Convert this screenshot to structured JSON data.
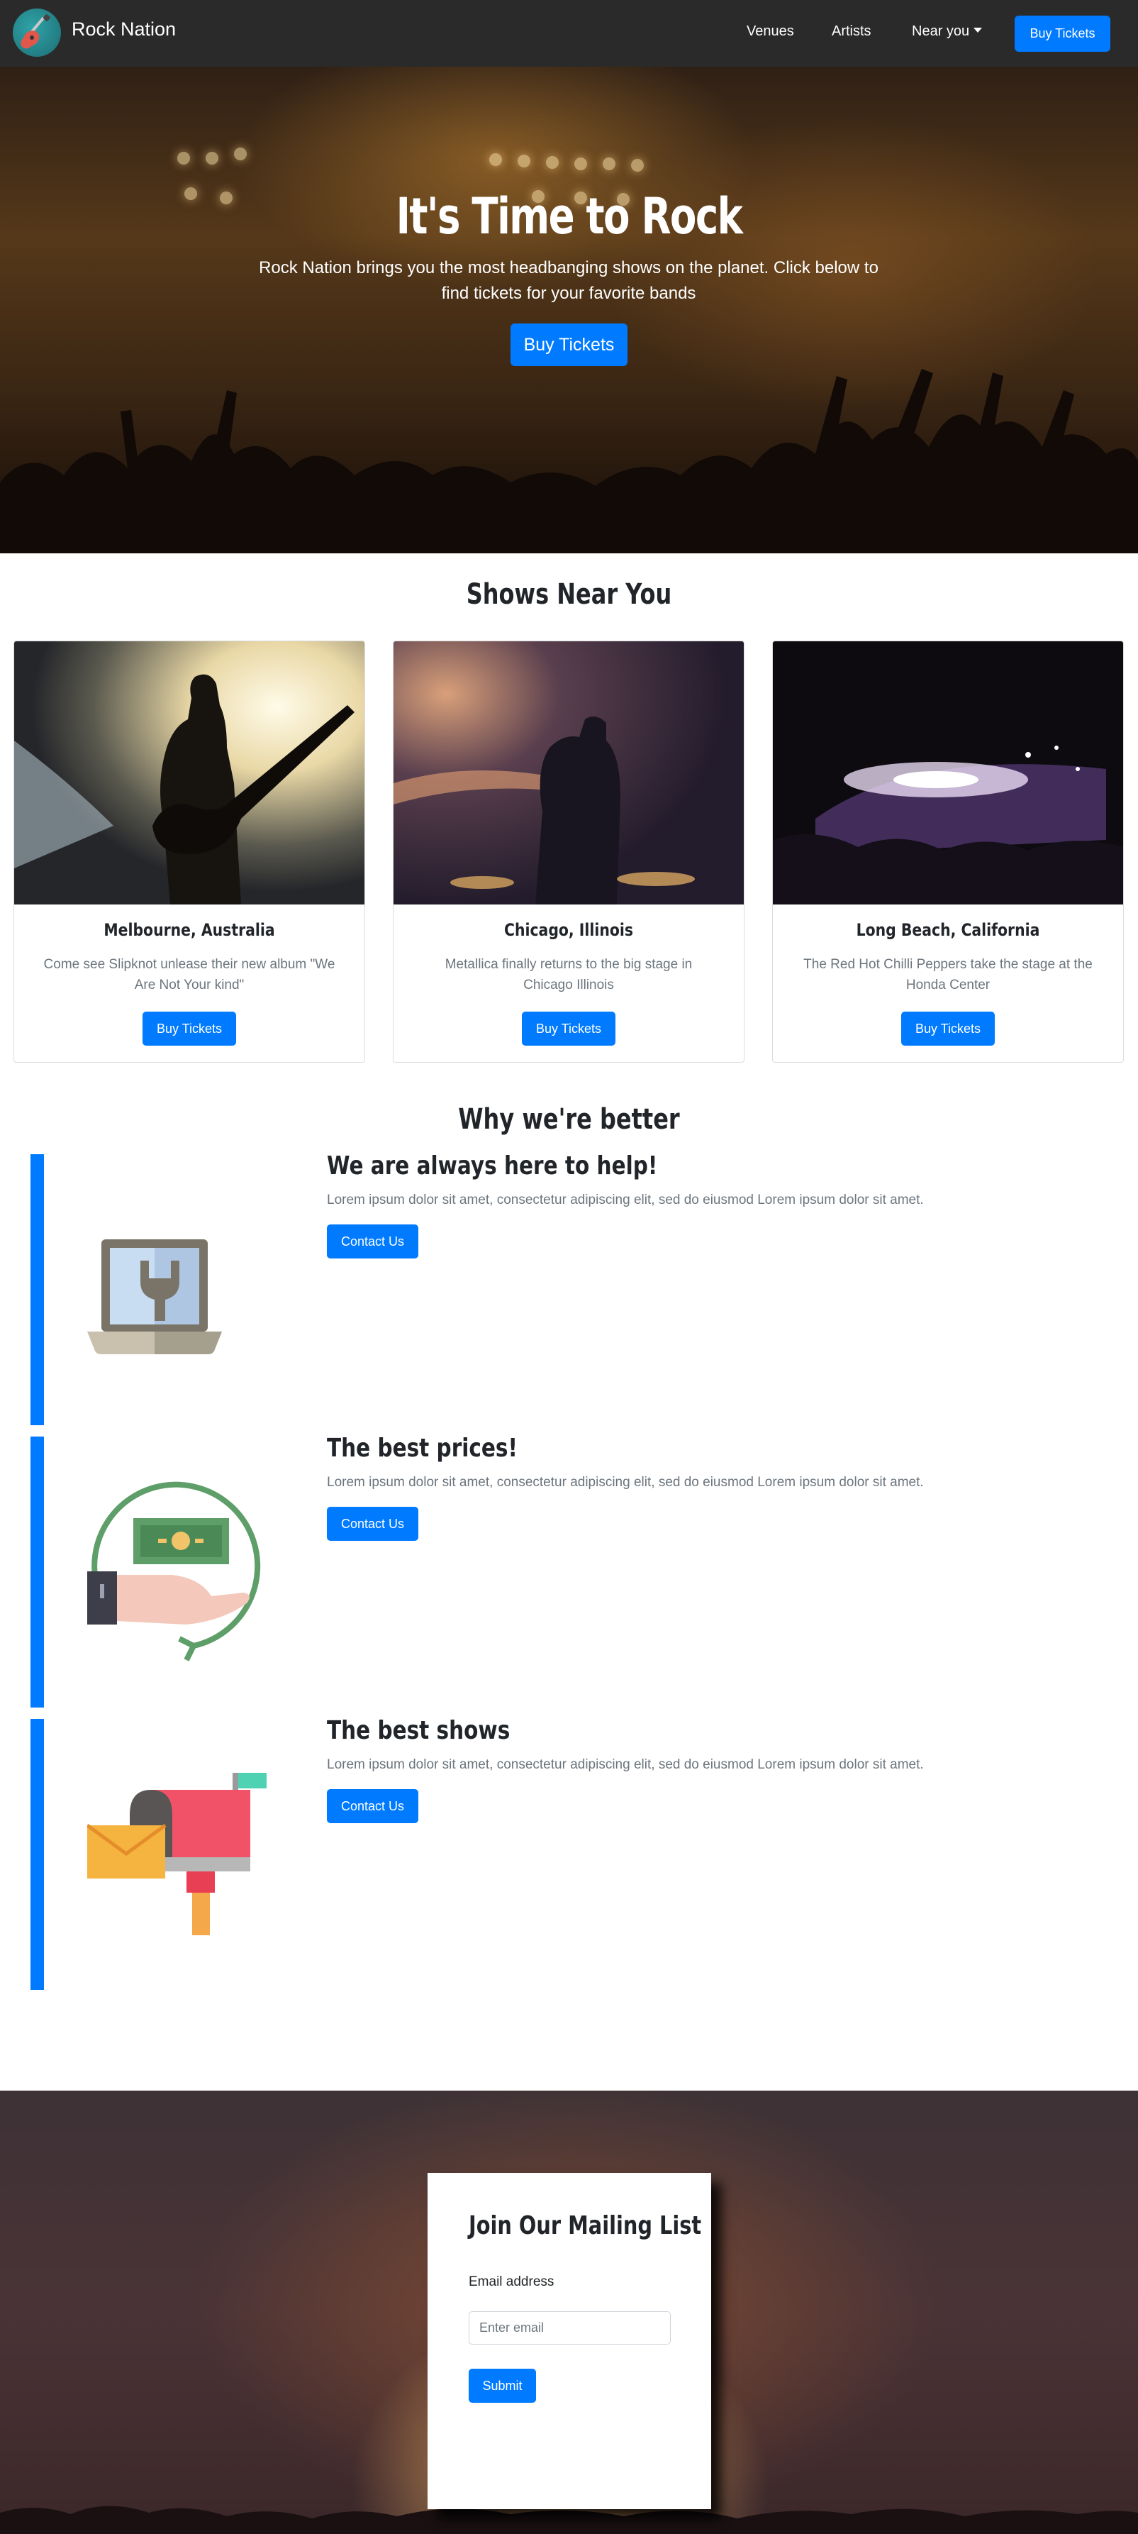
{
  "nav": {
    "brand": "Rock Nation",
    "links": [
      "Venues",
      "Artists",
      "Near you"
    ],
    "buy_label": "Buy Tickets"
  },
  "hero": {
    "title": "It's Time to Rock",
    "subtitle": "Rock Nation brings you the most headbanging shows on the planet. Click below to find tickets for your favorite bands",
    "button": "Buy Tickets"
  },
  "shows": {
    "heading": "Shows Near You",
    "cards": [
      {
        "title": "Melbourne, Australia",
        "text": "Come see Slipknot unlease their new album \"We Are Not Your kind\"",
        "button": "Buy Tickets"
      },
      {
        "title": "Chicago, Illinois",
        "text": "Metallica finally returns to the big stage in Chicago Illinois",
        "button": "Buy Tickets"
      },
      {
        "title": "Long Beach, California",
        "text": "The Red Hot Chilli Peppers take the stage at the Honda Center",
        "button": "Buy Tickets"
      }
    ]
  },
  "why": {
    "heading": "Why we're better",
    "features": [
      {
        "title": "We are always here to help!",
        "text": "Lorem ipsum dolor sit amet, consectetur adipiscing elit, sed do eiusmod Lorem ipsum dolor sit amet.",
        "button": "Contact Us",
        "icon": "laptop-wrench-icon"
      },
      {
        "title": "The best prices!",
        "text": "Lorem ipsum dolor sit amet, consectetur adipiscing elit, sed do eiusmod Lorem ipsum dolor sit amet.",
        "button": "Contact Us",
        "icon": "money-hand-icon"
      },
      {
        "title": "The best shows",
        "text": "Lorem ipsum dolor sit amet, consectetur adipiscing elit, sed do eiusmod Lorem ipsum dolor sit amet.",
        "button": "Contact Us",
        "icon": "mailbox-icon"
      }
    ]
  },
  "mailing": {
    "title": "Join Our Mailing List",
    "label": "Email address",
    "placeholder": "Enter email",
    "value": "",
    "submit": "Submit"
  },
  "colors": {
    "accent": "#007bff",
    "navbar": "#2a2a2a"
  }
}
